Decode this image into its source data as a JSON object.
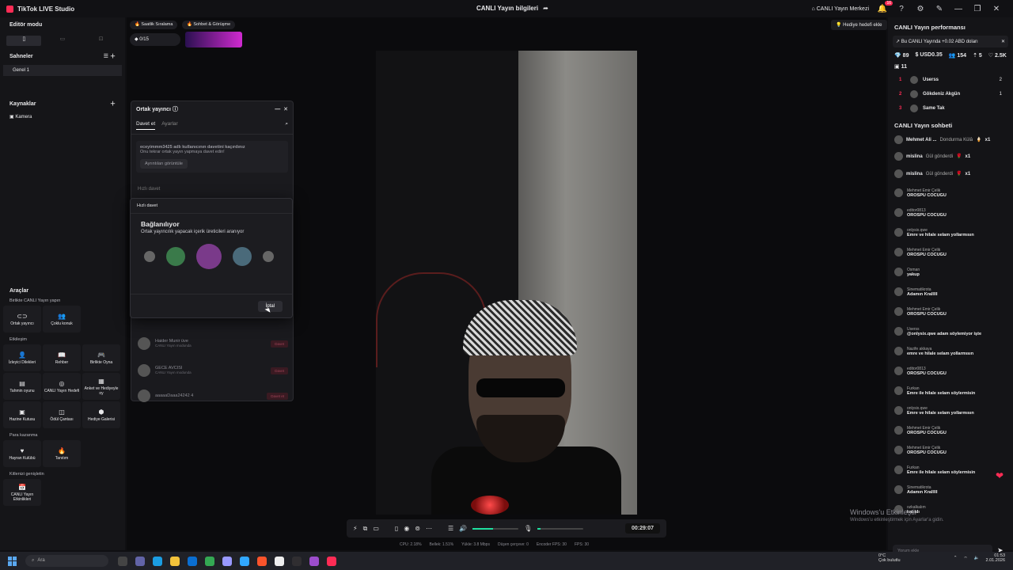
{
  "app": {
    "title": "TikTok LIVE Studio",
    "center_title": "CANLI Yayın bilgileri",
    "center_merkez": "CANLI Yayın Merkezi",
    "notif_count": "16"
  },
  "left": {
    "editor_mode": "Editör modu",
    "scenes_label": "Sahneler",
    "scene_item": "Genel 1",
    "sources_label": "Kaynaklar",
    "source_item": "Kamera",
    "tools_label": "Araçlar",
    "cat1": "Birlikte CANLI Yayın yapın",
    "cat2": "Etkileşim",
    "cat3": "Para kazanma",
    "cat4": "Kitlenizi genişletin",
    "tools": {
      "t1": "Ortak yayıncı",
      "t2": "Çoklu konuk",
      "t3": "İzleyici Dilekleri",
      "t4": "Rehber",
      "t5": "Birlikte Oyna",
      "t6": "Tahmin oyunu",
      "t7": "CANLI Yayın Hedefi",
      "t8": "Anket ve Hediyeyle oy",
      "t9": "Hazine Kutusu",
      "t10": "Ödül Çantası",
      "t11": "Hediye Galerisi",
      "t12": "Hayran Kulübü",
      "t13": "Tanıtım",
      "t14": "CANLI Yayın Etkinlikleri"
    }
  },
  "stage": {
    "chip1": "Saatlik Sıralama",
    "chip2": "Sohbet & Görüşme",
    "level": "0/15",
    "hedef": "Hediye hedefi ekle"
  },
  "cohost": {
    "title": "Ortak yayıncı",
    "tab_invite": "Davet et",
    "tab_settings": "Ayarlar",
    "notice_line1": "eceyimmm3425 adlı kullanıcının davetini kaçırdınız",
    "notice_line2": "Onu tekrar ortak yayın yapmaya davet edin!",
    "notice_btn": "Ayrıntıları görüntüle",
    "quick_invite": "Hızlı davet",
    "row1_name": "Haider Munir üve",
    "row1_sub": "CANLI Yayın modunda",
    "row1_btn": "Davet",
    "row2_name": "GECE AVCISI",
    "row2_sub": "CANLI Yayın modunda",
    "row2_btn": "Davet",
    "row3_name": "aaaaaDaaa24242 4",
    "row3_btn": "Davet et"
  },
  "modal": {
    "header": "Hızlı davet",
    "title": "Bağlanılıyor",
    "subtitle": "Ortak yayıncılık yapacak içerik üreticileri aranıyor",
    "cancel": "İptal"
  },
  "controls": {
    "timer": "00:29:07",
    "volume": 0.45,
    "mic": 0.02
  },
  "stats": {
    "cpu": "CPU: 2.18%",
    "mem": "Bellek: 1.51%",
    "upload": "Yükle: 3.8 Mbps",
    "drop": "Düşen çerçeve: 0",
    "enc": "Encoder FPS: 30",
    "fps": "FPS: 30"
  },
  "right": {
    "perf_title": "CANLI Yayın performansı",
    "perf_note": "Bu CANLI Yayında +0.02 ABD doları",
    "stats": {
      "diamonds": "89",
      "usd": "USD0.35",
      "viewers": "154",
      "new": "5",
      "likes": "2.5K",
      "gifts": "11"
    },
    "ranking": [
      {
        "num": "1",
        "name": "Userss",
        "score": "2"
      },
      {
        "num": "2",
        "name": "Gökdeniz Akgün",
        "score": "1"
      },
      {
        "num": "3",
        "name": "Same Tak",
        "score": ""
      }
    ],
    "chat_title": "CANLI Yayın sohbeti",
    "gift1": {
      "name": "Mehmet Ali ...",
      "text": "Dondurma Külâ",
      "count": "x1"
    },
    "gift2": {
      "name": "mislina",
      "text": "Gül gönderdi",
      "count": "x1"
    },
    "gift3": {
      "name": "mislina",
      "text": "Gül gönderdi",
      "count": "x1"
    },
    "messages": [
      {
        "name": "Mehmet Emir Çelik",
        "text": "OROSPU COCUGU"
      },
      {
        "name": "editor0813",
        "text": "OROSPU COCUGU"
      },
      {
        "name": "onlysix.qwe",
        "text": "Emre ve hilale selam yollarmısın"
      },
      {
        "name": "Mehmet Emir Çelik",
        "text": "OROSPU COCUGU"
      },
      {
        "name": "Osman",
        "text": "yakup"
      },
      {
        "name": "Sinematikrota",
        "text": "Adamın Kralllll"
      },
      {
        "name": "Mehmet Emir Çelik",
        "text": "OROSPU COCUGU"
      },
      {
        "name": "Userss",
        "text": "@onlysix.qwe adam söylemiyor işte"
      },
      {
        "name": "Nazife akkaya",
        "text": "emre ve hilale selam yollarmısın"
      },
      {
        "name": "editor0813",
        "text": "OROSPU COCUGU"
      },
      {
        "name": "Furkan",
        "text": "Emre ile hilale selam söylermisin"
      },
      {
        "name": "onlysix.qwe",
        "text": "Emre ve hilale selam yollarmısın"
      },
      {
        "name": "Mehmet Emir Çelik",
        "text": "OROSPU COCUGU"
      },
      {
        "name": "Mehmet Emir Çelik",
        "text": "OROSPU COCUGU"
      },
      {
        "name": "Furkan",
        "text": "Emre ile hilale selam söylermisin"
      },
      {
        "name": "Sinematikrota",
        "text": "Adamın Kralllll"
      },
      {
        "name": "ozkalkalım",
        "text": "katıldı"
      }
    ],
    "comment_placeholder": "Yorum ekle"
  },
  "windows": {
    "line1": "Windows'u Etkinleştir",
    "line2": "Windows'u etkinleştirmek için Ayarlar'a gidin."
  },
  "taskbar": {
    "search": "Ara",
    "weather_temp": "0°C",
    "weather_desc": "Çok bulutlu",
    "time": "01:53",
    "date": "2.01.2026"
  },
  "colors": {
    "accent": "#fe2c55",
    "green": "#1fe0a0"
  }
}
